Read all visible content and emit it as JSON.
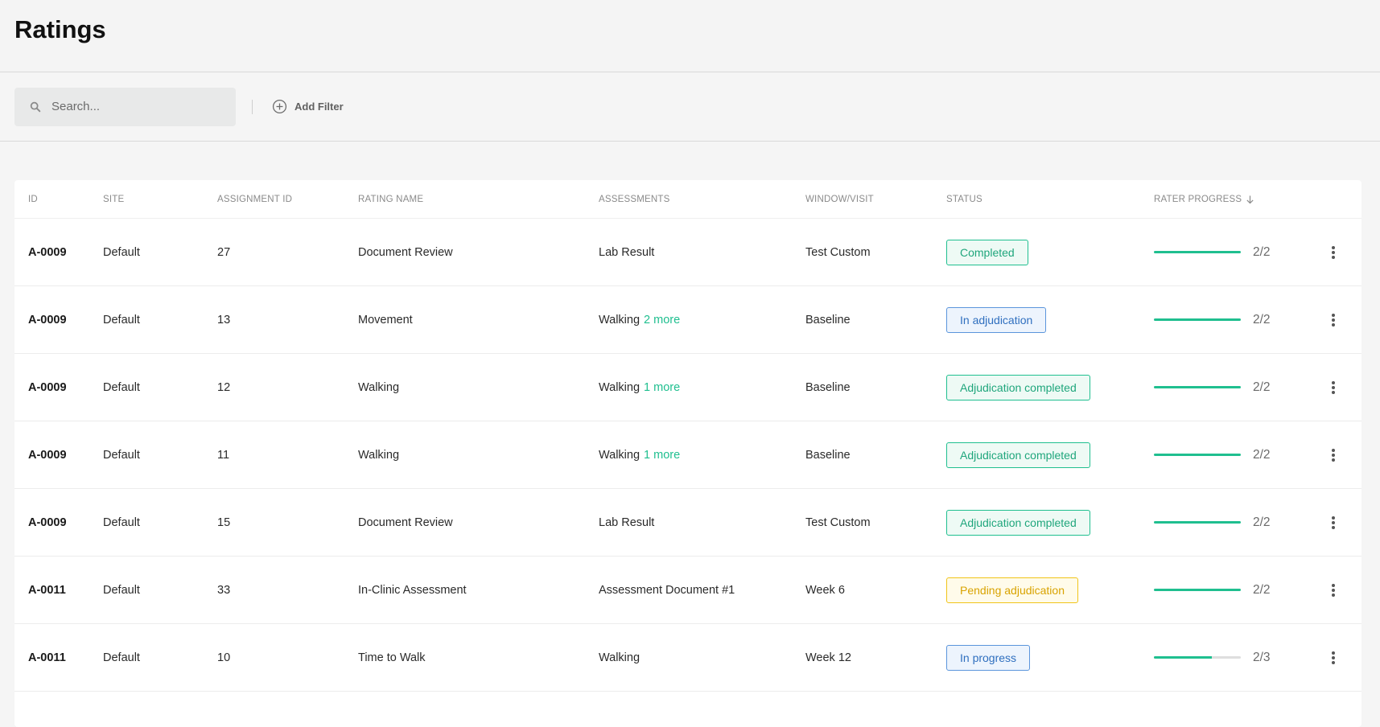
{
  "header": {
    "title": "Ratings"
  },
  "toolbar": {
    "search_placeholder": "Search...",
    "add_filter_label": "Add Filter"
  },
  "colors": {
    "accent": "#1fbf8f",
    "completed": "#1fbf8f",
    "in_adjudication": "#3b82d6",
    "pending": "#e0a800"
  },
  "table": {
    "columns": {
      "id": "ID",
      "site": "SITE",
      "assignment_id": "ASSIGNMENT ID",
      "rating_name": "RATING NAME",
      "assessments": "ASSESSMENTS",
      "window_visit": "WINDOW/VISIT",
      "status": "STATUS",
      "rater_progress": "RATER PROGRESS"
    },
    "rows": [
      {
        "id": "A-0009",
        "site": "Default",
        "assignment_id": "27",
        "rating_name": "Document Review",
        "assessment": "Lab Result",
        "more": "",
        "window": "Test Custom",
        "status": "Completed",
        "status_type": "green",
        "progress": 1.0,
        "progress_text": "2/2"
      },
      {
        "id": "A-0009",
        "site": "Default",
        "assignment_id": "13",
        "rating_name": "Movement",
        "assessment": "Walking",
        "more": "2 more",
        "window": "Baseline",
        "status": "In adjudication",
        "status_type": "blue",
        "progress": 1.0,
        "progress_text": "2/2"
      },
      {
        "id": "A-0009",
        "site": "Default",
        "assignment_id": "12",
        "rating_name": "Walking",
        "assessment": "Walking",
        "more": "1 more",
        "window": "Baseline",
        "status": "Adjudication completed",
        "status_type": "green",
        "progress": 1.0,
        "progress_text": "2/2"
      },
      {
        "id": "A-0009",
        "site": "Default",
        "assignment_id": "11",
        "rating_name": "Walking",
        "assessment": "Walking",
        "more": "1 more",
        "window": "Baseline",
        "status": "Adjudication completed",
        "status_type": "green",
        "progress": 1.0,
        "progress_text": "2/2"
      },
      {
        "id": "A-0009",
        "site": "Default",
        "assignment_id": "15",
        "rating_name": "Document Review",
        "assessment": "Lab Result",
        "more": "",
        "window": "Test Custom",
        "status": "Adjudication completed",
        "status_type": "green",
        "progress": 1.0,
        "progress_text": "2/2"
      },
      {
        "id": "A-0011",
        "site": "Default",
        "assignment_id": "33",
        "rating_name": "In-Clinic Assessment",
        "assessment": "Assessment Document #1",
        "more": "",
        "window": "Week 6",
        "status": "Pending adjudication",
        "status_type": "yellow",
        "progress": 1.0,
        "progress_text": "2/2"
      },
      {
        "id": "A-0011",
        "site": "Default",
        "assignment_id": "10",
        "rating_name": "Time to Walk",
        "assessment": "Walking",
        "more": "",
        "window": "Week 12",
        "status": "In progress",
        "status_type": "blue",
        "progress": 0.6667,
        "progress_text": "2/3"
      }
    ]
  }
}
